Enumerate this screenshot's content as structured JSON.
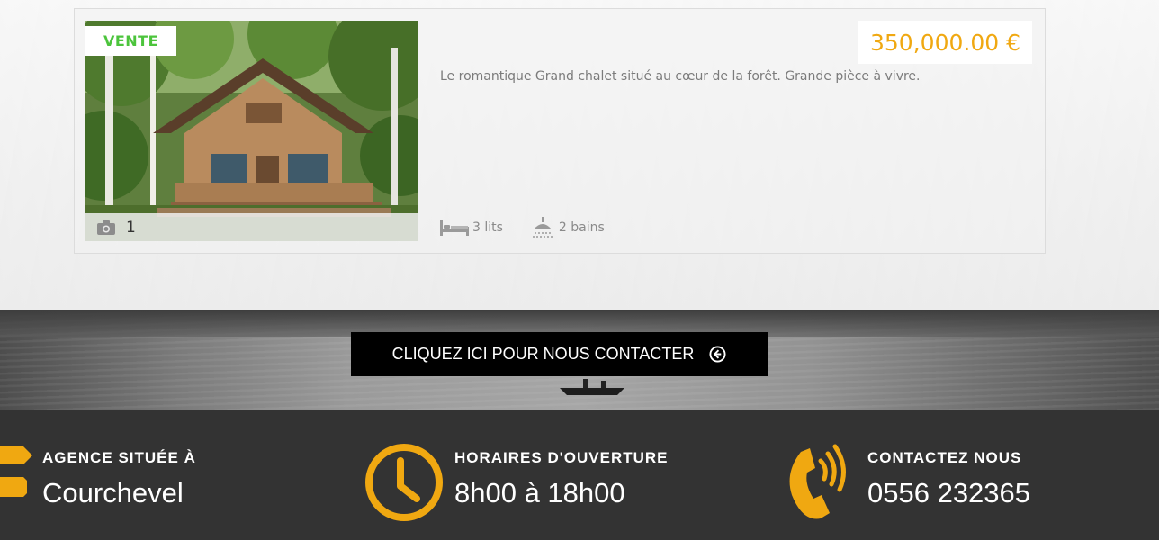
{
  "listing": {
    "badge": "VENTE",
    "price": "350,000.00 €",
    "description": "Le romantique Grand chalet situé au cœur de la forêt. Grande pièce à vivre.",
    "photo_count": "1",
    "beds": "3 lits",
    "baths": "2 bains"
  },
  "banner": {
    "contact_label": "CLIQUEZ ICI POUR NOUS CONTACTER"
  },
  "footer": {
    "location": {
      "label": "AGENCE SITUÉE À",
      "value": "Courchevel",
      "icon": "map-pointer-icon"
    },
    "hours": {
      "label": "HORAIRES D'OUVERTURE",
      "value": "8h00 à 18h00",
      "icon": "clock-icon"
    },
    "contact": {
      "label": "CONTACTEZ NOUS",
      "value": "0556 232365",
      "icon": "phone-icon"
    }
  },
  "colors": {
    "accent": "#f0a811",
    "badge_green": "#4cc43c",
    "footer_bg": "#333333",
    "button_bg": "#000000"
  }
}
